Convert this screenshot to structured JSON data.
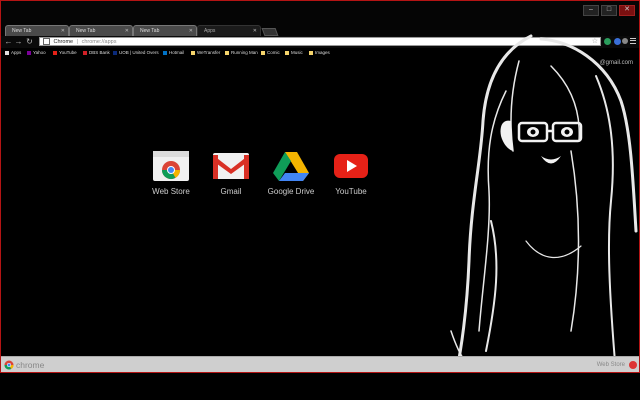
{
  "tabs": [
    {
      "label": "New Tab"
    },
    {
      "label": "New Tab"
    },
    {
      "label": "New Tab"
    },
    {
      "label": "Apps"
    }
  ],
  "toolbar": {
    "back_icon": "arrow-left",
    "forward_icon": "arrow-right",
    "reload_icon": "reload",
    "omnibox": {
      "scheme": "Chrome",
      "url": "chrome://apps"
    }
  },
  "bookmarks": [
    {
      "label": "Apps",
      "icon": "apps-grid",
      "color": "#e0e0e0"
    },
    {
      "label": "Yahoo",
      "icon": "yahoo",
      "color": "#7b0099"
    },
    {
      "label": "YouTube",
      "icon": "youtube",
      "color": "#e62117"
    },
    {
      "label": "DBS Bank",
      "icon": "bank",
      "color": "#d21f26"
    },
    {
      "label": "UOB | United Overs",
      "icon": "bank",
      "color": "#0a2a7a"
    },
    {
      "label": "Hotmail",
      "icon": "mail",
      "color": "#0072c6"
    },
    {
      "label": "WeTransfer",
      "icon": "folder",
      "color": "#f5d46c"
    },
    {
      "label": "Running Man",
      "icon": "folder",
      "color": "#f5d46c"
    },
    {
      "label": "Comic",
      "icon": "folder",
      "color": "#f5d46c"
    },
    {
      "label": "Music",
      "icon": "folder",
      "color": "#f5d46c"
    },
    {
      "label": "Images",
      "icon": "folder",
      "color": "#f5d46c"
    }
  ],
  "account": {
    "email_fragment": "@gmail.com"
  },
  "apps": [
    {
      "label": "Web Store",
      "icon": "web-store-icon"
    },
    {
      "label": "Gmail",
      "icon": "gmail-icon"
    },
    {
      "label": "Google Drive",
      "icon": "google-drive-icon"
    },
    {
      "label": "YouTube",
      "icon": "youtube-icon"
    }
  ],
  "bottombar": {
    "brand": "chrome",
    "store_label": "Web Store"
  },
  "colors": {
    "frame_border": "#b41414",
    "background": "#000000",
    "bottombar": "#cfcfcf"
  }
}
